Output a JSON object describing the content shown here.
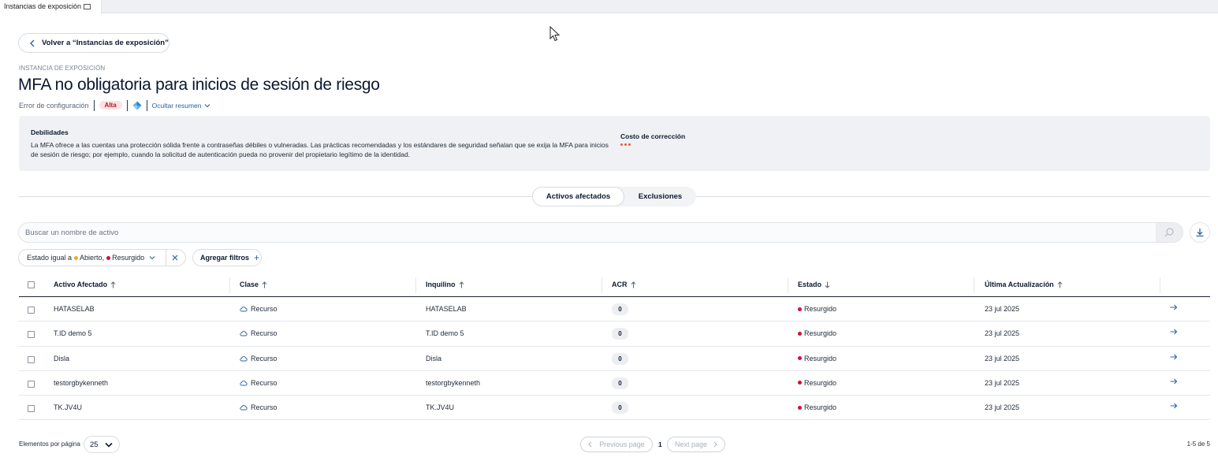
{
  "browser_tab": {
    "title": "Instancias de exposición"
  },
  "back_button": {
    "label": "Volver a “Instancias de exposición”"
  },
  "header": {
    "eyebrow": "INSTANCIA DE EXPOSICIÓN",
    "title": "MFA no obligatoria para inicios de sesión de riesgo",
    "category": "Error de configuración",
    "severity": "Alta",
    "severity_color": "#b3132b",
    "summary_toggle": "Ocultar resumen"
  },
  "summary": {
    "weakness_title": "Debilidades",
    "weakness_text": "La MFA ofrece a las cuentas una protección sólida frente a contraseñas débiles o vulneradas. Las prácticas recomendadas y los estándares de seguridad señalan que se exija la MFA para inicios de sesión de riesgo; por ejemplo, cuando la solicitud de autenticación pueda no provenir del propietario legítimo de la identidad.",
    "cost_title": "Costo de corrección",
    "cost_color": "#e85a3c"
  },
  "tabs": [
    {
      "label": "Activos afectados",
      "active": true
    },
    {
      "label": "Exclusiones",
      "active": false
    }
  ],
  "search": {
    "placeholder": "Buscar un nombre de activo",
    "value": ""
  },
  "filters": {
    "chip_prefix": "Estado igual a",
    "values": [
      {
        "label": "Abierto,",
        "color": "#f5a623"
      },
      {
        "label": "Resurgido",
        "color": "#d10f37"
      }
    ],
    "add_label": "Agregar filtros"
  },
  "table": {
    "columns": [
      {
        "label": "Activo Afectado",
        "sort": "up"
      },
      {
        "label": "Clase",
        "sort": "up"
      },
      {
        "label": "Inquilino",
        "sort": "up"
      },
      {
        "label": "ACR",
        "sort": "up"
      },
      {
        "label": "Estado",
        "sort": "down"
      },
      {
        "label": "Última Actualización",
        "sort": "up"
      }
    ],
    "rows": [
      {
        "asset": "HATASELAB",
        "class": "Recurso",
        "tenant": "HATASELAB",
        "acr": "0",
        "status": "Resurgido",
        "updated": "23 jul 2025"
      },
      {
        "asset": "T.ID demo 5",
        "class": "Recurso",
        "tenant": "T.ID demo 5",
        "acr": "0",
        "status": "Resurgido",
        "updated": "23 jul 2025"
      },
      {
        "asset": "Disla",
        "class": "Recurso",
        "tenant": "Disla",
        "acr": "0",
        "status": "Resurgido",
        "updated": "23 jul 2025"
      },
      {
        "asset": "testorgbykenneth",
        "class": "Recurso",
        "tenant": "testorgbykenneth",
        "acr": "0",
        "status": "Resurgido",
        "updated": "23 jul 2025"
      },
      {
        "asset": "TK.JV4U",
        "class": "Recurso",
        "tenant": "TK.JV4U",
        "acr": "0",
        "status": "Resurgido",
        "updated": "23 jul 2025"
      }
    ],
    "status_color": "#d10f37"
  },
  "pagination": {
    "per_page_label": "Elementos por página",
    "per_page_value": "25",
    "prev_label": "Previous page",
    "next_label": "Next page",
    "current_page": "1",
    "range_text": "1-5 de 5"
  }
}
